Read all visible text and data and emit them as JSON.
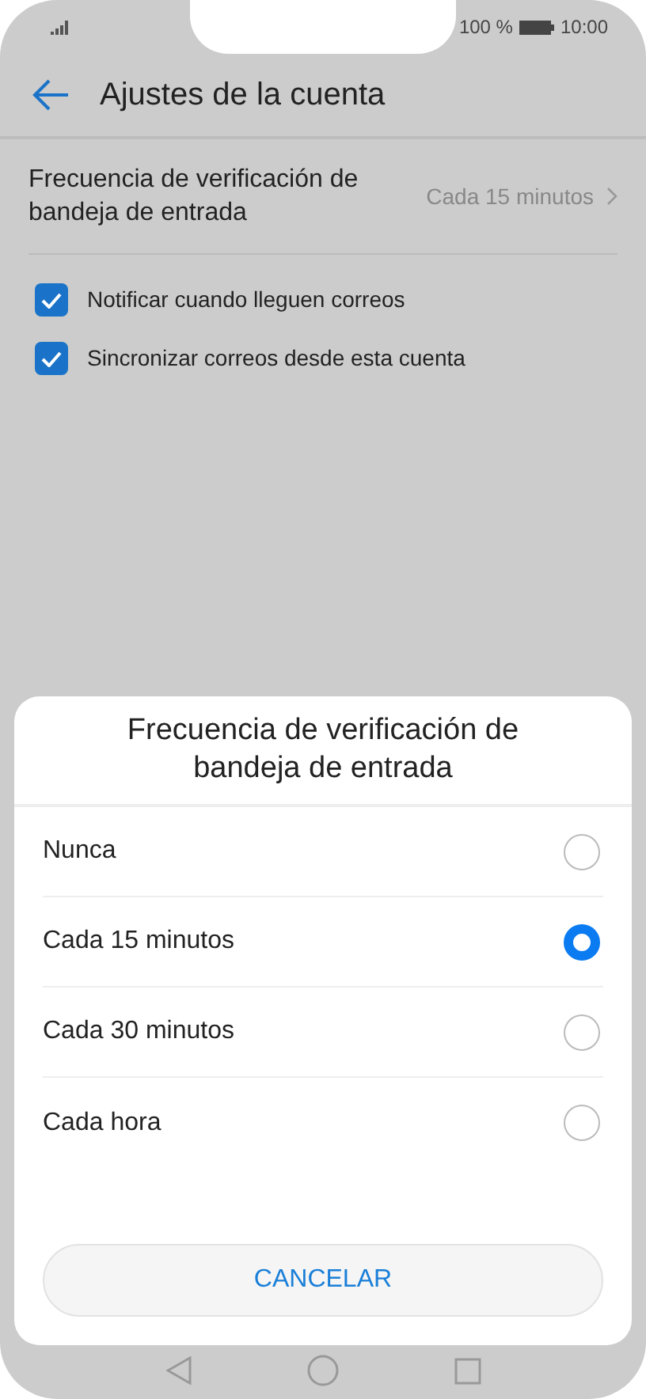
{
  "status_bar": {
    "battery": "100 %",
    "time": "10:00"
  },
  "app_bar": {
    "title": "Ajustes de la cuenta"
  },
  "setting": {
    "label": "Frecuencia de verificación de bandeja de entrada",
    "value": "Cada 15 minutos"
  },
  "checkboxes": [
    {
      "label": "Notificar cuando lleguen correos",
      "checked": true
    },
    {
      "label": "Sincronizar correos desde esta cuenta",
      "checked": true
    }
  ],
  "dialog": {
    "title": "Frecuencia de verificación de bandeja de entrada",
    "options": [
      {
        "label": "Nunca",
        "selected": false
      },
      {
        "label": "Cada 15 minutos",
        "selected": true
      },
      {
        "label": "Cada 30 minutos",
        "selected": false
      },
      {
        "label": "Cada hora",
        "selected": false
      }
    ],
    "cancel": "CANCELAR"
  }
}
